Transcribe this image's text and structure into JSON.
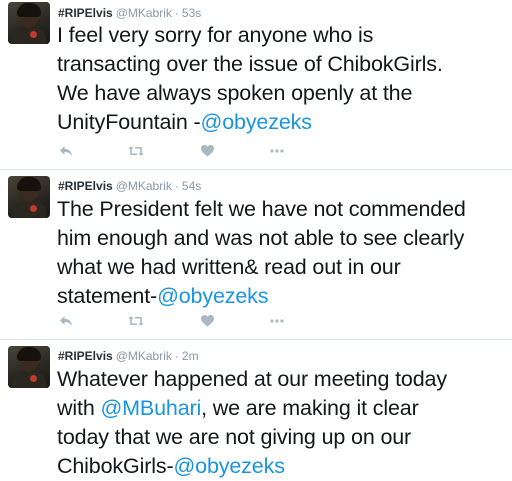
{
  "tweets": [
    {
      "display_name": "#RIPElvis",
      "screen_name": "@MKabrik",
      "separator": "·",
      "time": "53s",
      "lines": [
        [
          {
            "t": "I feel very sorry for anyone who is"
          }
        ],
        [
          {
            "t": "transacting over the issue of ChibokGirls."
          }
        ],
        [
          {
            "t": "We have always spoken openly at the"
          }
        ],
        [
          {
            "t": "UnityFountain -"
          },
          {
            "t": "@obyezeks",
            "mention": true
          }
        ]
      ]
    },
    {
      "display_name": "#RIPElvis",
      "screen_name": "@MKabrik",
      "separator": "·",
      "time": "54s",
      "lines": [
        [
          {
            "t": "The President felt we have not commended"
          }
        ],
        [
          {
            "t": "him enough and was not able to see clearly"
          }
        ],
        [
          {
            "t": "what we had written& read out in our"
          }
        ],
        [
          {
            "t": "statement-"
          },
          {
            "t": "@obyezeks",
            "mention": true
          }
        ]
      ]
    },
    {
      "display_name": "#RIPElvis",
      "screen_name": "@MKabrik",
      "separator": "·",
      "time": "2m",
      "lines": [
        [
          {
            "t": "Whatever happened at our meeting today"
          }
        ],
        [
          {
            "t": "with "
          },
          {
            "t": "@MBuhari",
            "mention": true
          },
          {
            "t": ", we are making it clear"
          }
        ],
        [
          {
            "t": "today that we are not giving up on our"
          }
        ],
        [
          {
            "t": "ChibokGirls-"
          },
          {
            "t": "@obyezeks",
            "mention": true
          }
        ]
      ]
    }
  ],
  "icons": {
    "reply": "reply-icon",
    "retweet": "retweet-icon",
    "like": "heart-icon",
    "more": "more-icon"
  },
  "colors": {
    "text": "#14171a",
    "mention": "#1b95e0",
    "meta": "#8899a6",
    "action_icon": "#aab8c2",
    "divider": "#e1e8ed"
  }
}
